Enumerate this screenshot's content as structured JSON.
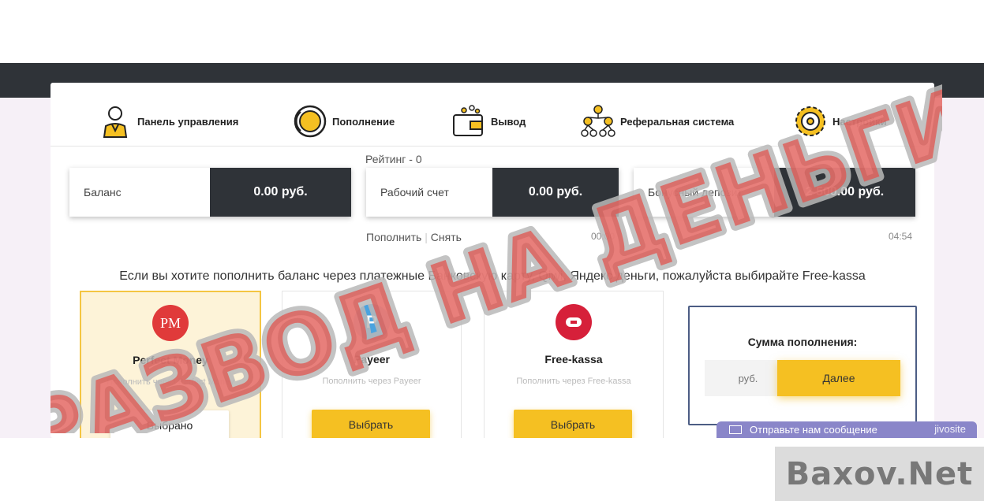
{
  "nav": {
    "items": [
      {
        "label": "Панель управления",
        "icon": "user-icon"
      },
      {
        "label": "Пополнение",
        "icon": "coin-icon"
      },
      {
        "label": "Вывод",
        "icon": "wallet-icon"
      },
      {
        "label": "Реферальная система",
        "icon": "referral-tree-icon"
      },
      {
        "label": "Настройки",
        "icon": "gear-icon"
      }
    ]
  },
  "rating": "Рейтинг - 0",
  "balances": [
    {
      "label": "Баланс",
      "value": "0.00 руб."
    },
    {
      "label": "Рабочий счет",
      "value": "0.00 руб."
    },
    {
      "label": "Бонусный депозит",
      "value": "2 500.00 руб."
    }
  ],
  "links": {
    "deposit": "Пополнить",
    "withdraw": "Снять"
  },
  "timers": {
    "t1": "00:00",
    "t2": "04:54"
  },
  "heading": "Если вы хотите пополнить баланс через платежные Банковскую карту, Qiwi, Яндекс деньги, пожалуйста выбирайте Free-kassa",
  "payments": [
    {
      "name": "Perfect Money",
      "sub": "Пополнить через Perfect Money",
      "button": "Выбрано",
      "logo_text": "PM"
    },
    {
      "name": "Payeer",
      "sub": "Пополнить через Payeer",
      "button": "Выбрать",
      "logo_text": "P"
    },
    {
      "name": "Free-kassa",
      "sub": "Пополнить через Free-kassa",
      "button": "Выбрать",
      "logo_text": ""
    }
  ],
  "sum": {
    "title": "Сумма пополнения:",
    "placeholder": "руб.",
    "next": "Далее"
  },
  "chat": {
    "label": "Отправьте нам сообщение",
    "brand": "jivosite"
  },
  "overlay": {
    "stamp": "РАЗВОД НА ДЕНЬГИ",
    "watermark": "Baxov.Net"
  },
  "colors": {
    "accent": "#f5c022",
    "dark": "#2f3338",
    "stamp": "#e0544f"
  }
}
